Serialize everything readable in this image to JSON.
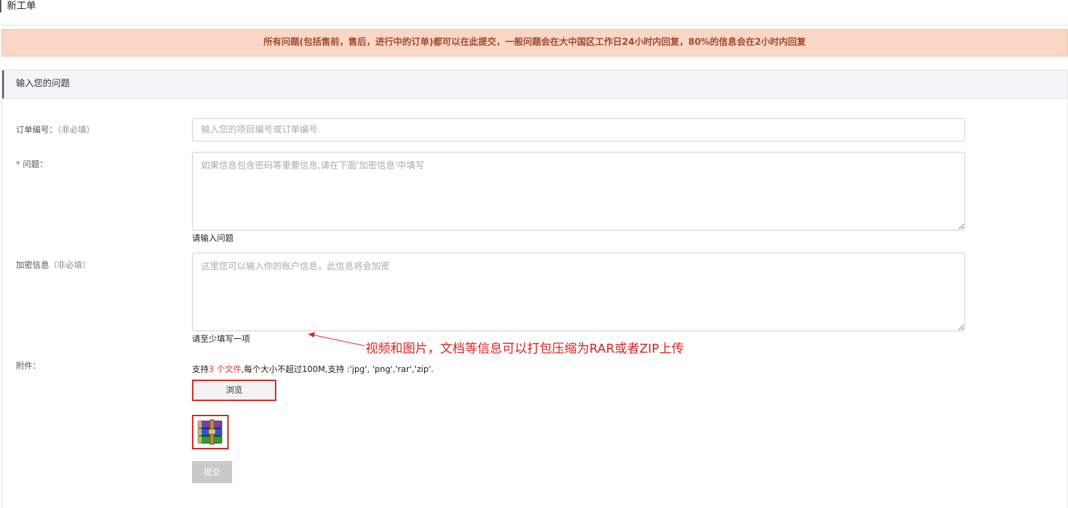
{
  "page": {
    "title": "新工单"
  },
  "notice": {
    "text": "所有问题(包括售前，售后，进行中的订单)都可以在此提交，一般问题会在大中国区工作日24小时内回复，80%的信息会在2小时内回复"
  },
  "panel": {
    "header": "输入您的问题"
  },
  "form": {
    "order": {
      "label": "订单编号：",
      "optional": "（非必填）",
      "placeholder": "输入您的项目编号或订单编号",
      "value": ""
    },
    "question": {
      "required_mark": "*",
      "label": "问题：",
      "placeholder": "如果信息包含密码等重要信息,请在下面'加密信息'中填写",
      "hint": "请输入问题",
      "value": ""
    },
    "encrypted": {
      "label": "加密信息",
      "optional": "（非必填）",
      "placeholder": "这里您可以输入你的账户信息，此信息将会加密",
      "hint": "请至少填写一项",
      "value": ""
    },
    "attachment": {
      "label": "附件：",
      "note_prefix": "支持",
      "note_count": "3 个文件",
      "note_suffix": ",每个大小不超过100M,支持 :'jpg', 'png','rar','zip'.",
      "browse_label": "浏览",
      "file_icon": "winrar-archive-icon"
    },
    "submit_label": "提交"
  },
  "annotation": {
    "text": "视频和图片，文档等信息可以打包压缩为RAR或者ZIP上传",
    "color": "#e02020"
  }
}
